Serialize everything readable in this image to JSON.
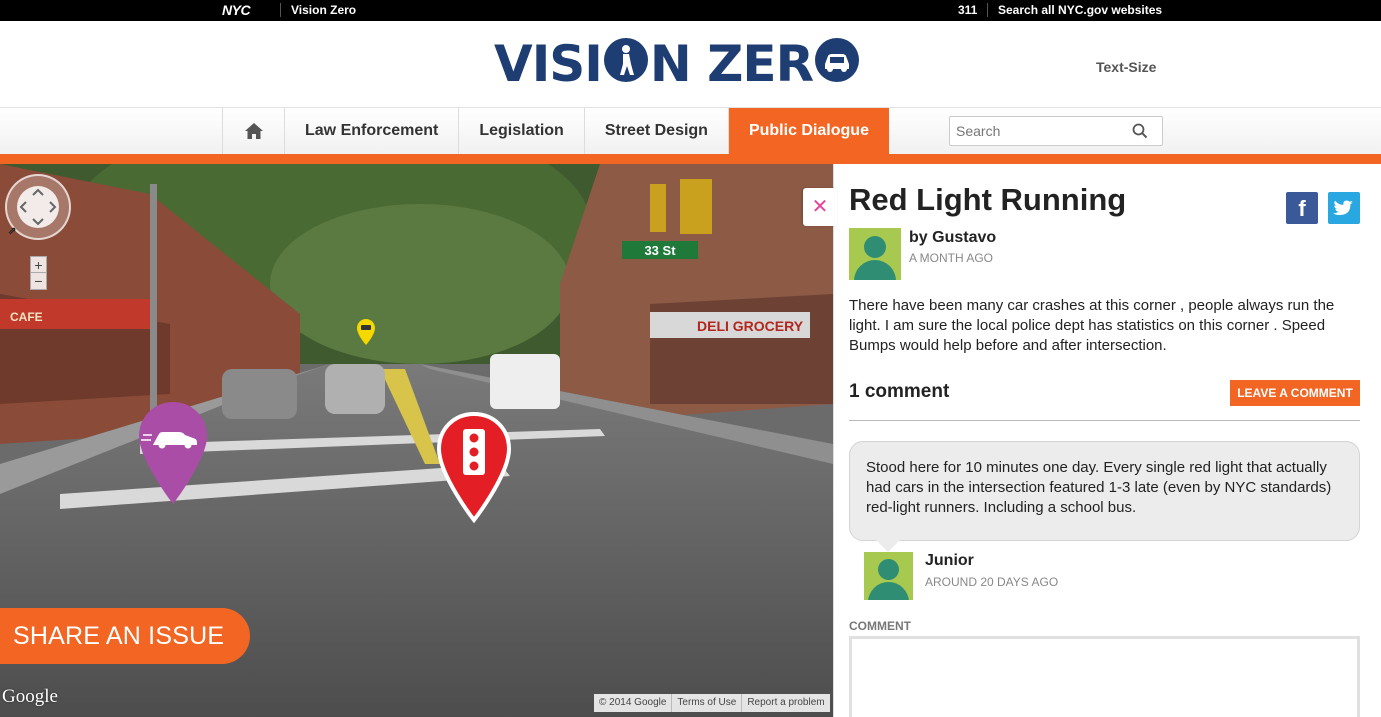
{
  "topbar": {
    "nyc_logo": "NYC",
    "site_link": "Vision Zero",
    "link_311": "311",
    "search_all": "Search all NYC.gov websites"
  },
  "header": {
    "logo_text_left": "VISI",
    "logo_text_mid": "N ZER",
    "logo_alt": "VISION ZERO",
    "text_size": "Text-Size"
  },
  "nav": {
    "home_icon": "home-icon",
    "items": [
      {
        "label": "Law Enforcement",
        "active": false
      },
      {
        "label": "Legislation",
        "active": false
      },
      {
        "label": "Street Design",
        "active": false
      },
      {
        "label": "Public Dialogue",
        "active": true
      }
    ],
    "search_placeholder": "Search",
    "accent_color": "#f26522"
  },
  "streetview": {
    "street_sign": "33 St",
    "store_sign": "DELI GROCERY",
    "cafe_sign": "CAFE",
    "share_button": "SHARE AN ISSUE",
    "google_logo": "Google",
    "attribution": [
      "© 2014 Google",
      "Terms of Use",
      "Report a problem"
    ],
    "pins": [
      {
        "icon": "car-speeding-icon",
        "color": "#a94da6"
      },
      {
        "icon": "traffic-light-icon",
        "color": "#e31e24"
      },
      {
        "icon": "car-icon",
        "color": "#f5d800"
      }
    ]
  },
  "issue": {
    "title": "Red Light Running",
    "author": "by Gustavo",
    "time": "A MONTH AGO",
    "body": "There have been many car crashes at this corner , people always run the light. I am sure the local police dept has statistics on this corner . Speed Bumps would help before and after intersection.",
    "share_facebook": "f",
    "comments_count": "1 comment",
    "leave_comment": "LEAVE A COMMENT"
  },
  "comments": [
    {
      "text": "Stood here for 10 minutes one day. Every single red light that actually had cars in the intersection featured 1-3 late (even by NYC standards) red-light runners. Including a school bus.",
      "author": "Junior",
      "time": "AROUND 20 DAYS AGO"
    }
  ],
  "comment_form": {
    "label": "COMMENT",
    "value": ""
  }
}
